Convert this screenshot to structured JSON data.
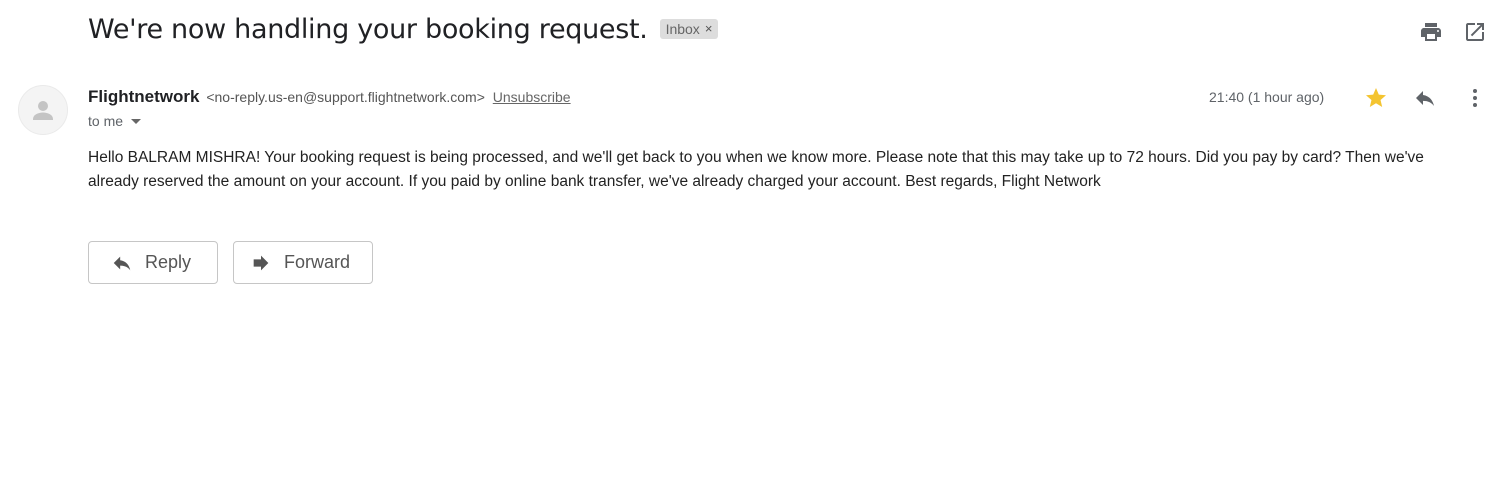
{
  "email": {
    "subject": "We're now handling your booking request.",
    "label_badge": "Inbox",
    "label_badge_close": "×",
    "sender_name": "Flightnetwork",
    "sender_email": "<no-reply.us-en@support.flightnetwork.com>",
    "unsubscribe_label": "Unsubscribe",
    "recipient": "to me",
    "timestamp": "21:40 (1 hour ago)",
    "starred": true,
    "body": "Hello BALRAM MISHRA! Your booking request is being processed, and we'll get back to you when we know more. Please note that this may take up to 72 hours. Did you pay by card? Then we've already reserved the amount on your account. If you paid by online bank transfer, we've already charged your account. Best regards,  Flight Network"
  },
  "actions": {
    "reply_label": "Reply",
    "forward_label": "Forward"
  },
  "icons": {
    "print": "print-icon",
    "open_new_window": "open-in-new-window-icon",
    "star": "star-icon",
    "reply": "reply-icon",
    "more": "more-vertical-icon",
    "avatar": "person-icon",
    "forward": "forward-icon"
  },
  "colors": {
    "star": "#f4c430",
    "icon_gray": "#5f6368",
    "badge_bg": "#dddddd",
    "button_border": "#c6c6c6"
  }
}
